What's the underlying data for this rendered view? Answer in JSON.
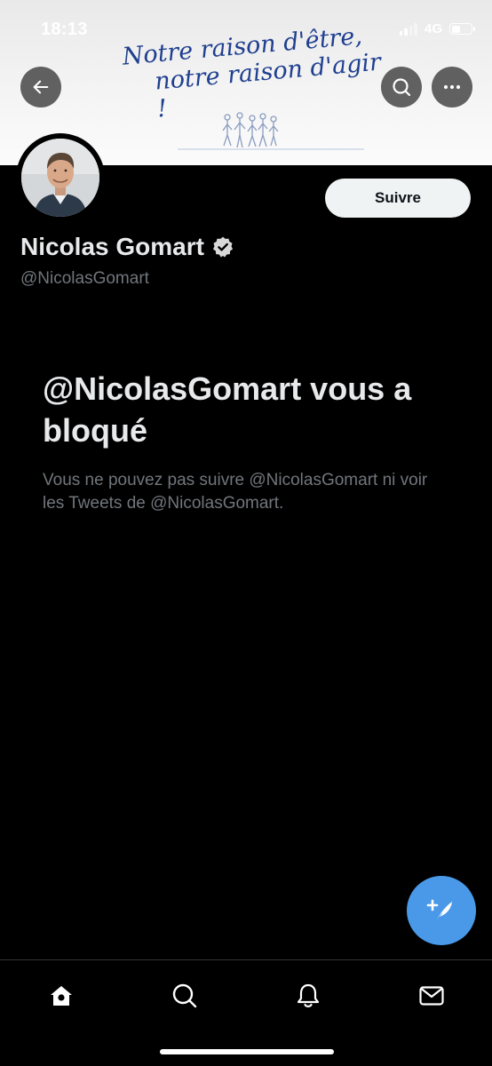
{
  "status_bar": {
    "time": "18:13",
    "network": "4G"
  },
  "banner": {
    "slogan_line1": "Notre raison d'être,",
    "slogan_line2": "notre raison d'agir !"
  },
  "profile": {
    "name": "Nicolas Gomart",
    "handle": "@NicolasGomart",
    "verified": true,
    "follow_label": "Suivre"
  },
  "blocked": {
    "title": "@NicolasGomart vous a bloqué",
    "description": "Vous ne pouvez pas suivre @NicolasGomart ni voir les Tweets de @NicolasGomart."
  },
  "colors": {
    "accent": "#4a99e9",
    "background": "#000000",
    "secondary_text": "#71767b",
    "slogan": "#1f3f8f"
  },
  "icons": {
    "back": "back-arrow-icon",
    "search": "search-icon",
    "more": "more-icon",
    "verified": "verified-badge-icon",
    "compose": "compose-tweet-icon",
    "tabs": [
      "home-icon",
      "search-icon",
      "notifications-icon",
      "messages-icon"
    ]
  }
}
